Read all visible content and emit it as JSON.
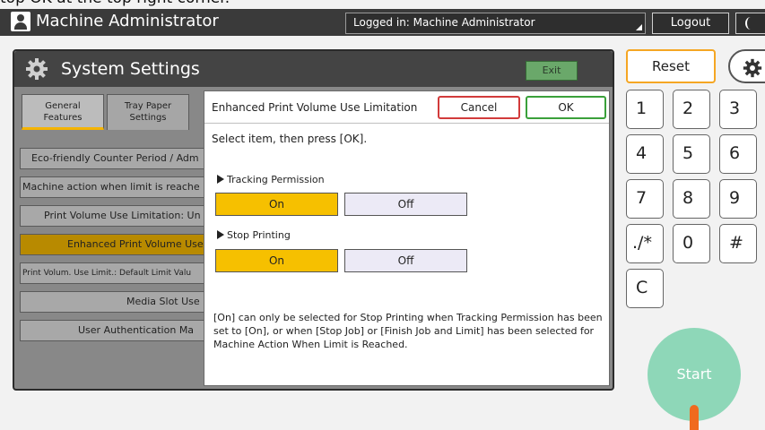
{
  "caption": "top OK at the top right corner.",
  "topbar": {
    "user_name": "Machine Administrator",
    "login_status": "Logged in: Machine Administrator",
    "logout_label": "Logout"
  },
  "system_settings": {
    "title": "System Settings",
    "exit_label": "Exit",
    "tabs": [
      {
        "line1": "General",
        "line2": "Features"
      },
      {
        "line1": "Tray Paper",
        "line2": "Settings"
      }
    ],
    "list_items": [
      "Eco-friendly Counter Period / Adm",
      "Machine action when limit is reache",
      "Print Volume Use Limitation: Un",
      "Enhanced Print Volume Use",
      "Print Volum. Use Limit.: Default Limit Valu",
      "Media Slot Use",
      "User Authentication Ma"
    ]
  },
  "dialog": {
    "title": "Enhanced Print Volume Use Limitation",
    "cancel_label": "Cancel",
    "ok_label": "OK",
    "instruction": "Select item, then press [OK].",
    "tracking_label": "Tracking Permission",
    "tracking_on": "On",
    "tracking_off": "Off",
    "stop_label": "Stop Printing",
    "stop_on": "On",
    "stop_off": "Off",
    "note": "[On] can only be selected for Stop Printing when Tracking Permission has been set to [On], or when [Stop Job] or [Finish Job and Limit] has been selected for Machine Action When Limit is Reached."
  },
  "right_panel": {
    "reset_label": "Reset",
    "keys": [
      "1",
      "2",
      "3",
      "4",
      "5",
      "6",
      "7",
      "8",
      "9",
      "./*",
      "0",
      "#",
      "C"
    ],
    "start_label": "Start"
  },
  "colors": {
    "accent_yellow": "#f6c000",
    "reset_border": "#f5a623",
    "ok_border": "#3aa03a",
    "cancel_border": "#d23b3b",
    "start_green": "#8ed7b8"
  }
}
